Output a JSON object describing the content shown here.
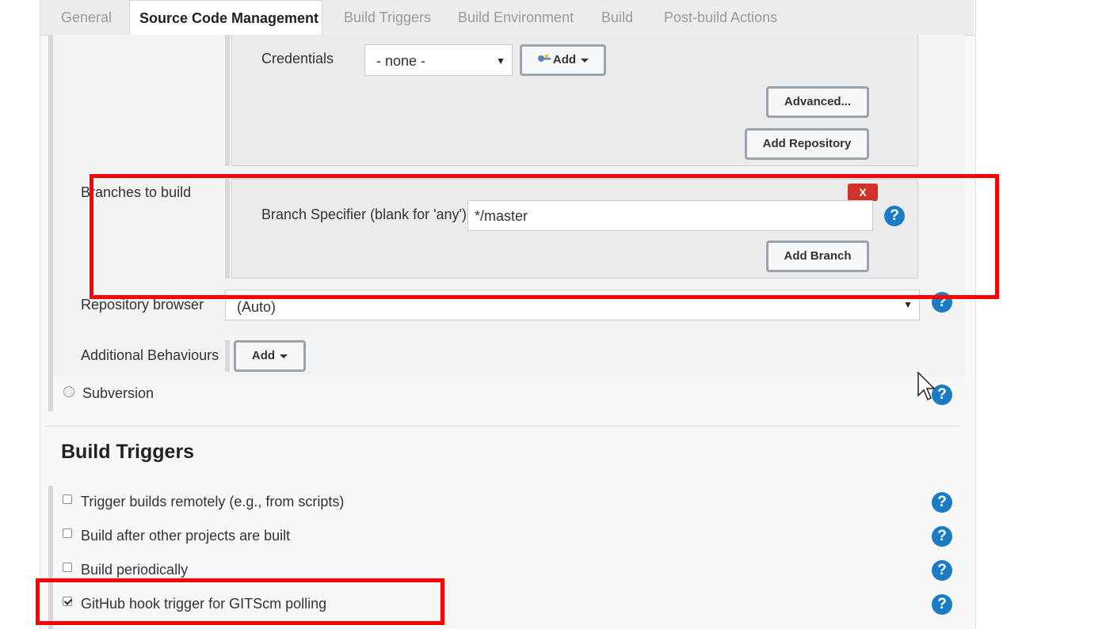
{
  "tabs": [
    "General",
    "Source Code Management",
    "Build Triggers",
    "Build Environment",
    "Build",
    "Post-build Actions"
  ],
  "active_tab": "Source Code Management",
  "credentials": {
    "label": "Credentials",
    "value": "- none -",
    "add_label": "Add"
  },
  "buttons": {
    "advanced": "Advanced...",
    "add_repository": "Add Repository",
    "add_branch": "Add Branch",
    "delete_branch": "X",
    "add_behaviour": "Add"
  },
  "branches": {
    "label": "Branches to build",
    "specifier_label": "Branch Specifier (blank for 'any')",
    "specifier_value": "*/master"
  },
  "repository_browser": {
    "label": "Repository browser",
    "value": "(Auto)"
  },
  "additional_behaviours": {
    "label": "Additional Behaviours"
  },
  "scm_options": {
    "subversion": "Subversion"
  },
  "build_triggers": {
    "heading": "Build Triggers",
    "items": [
      {
        "label": "Trigger builds remotely (e.g., from scripts)",
        "checked": false
      },
      {
        "label": "Build after other projects are built",
        "checked": false
      },
      {
        "label": "Build periodically",
        "checked": false
      },
      {
        "label": "GitHub hook trigger for GITScm polling",
        "checked": true
      }
    ]
  },
  "icons": {
    "help": "?",
    "dropdown_arrow": "▼",
    "caret": "caret-down-icon",
    "credential_key": "key-icon"
  },
  "colors": {
    "highlight": "#ff0000",
    "help": "#1a7cc4",
    "delete": "#d0312d"
  }
}
